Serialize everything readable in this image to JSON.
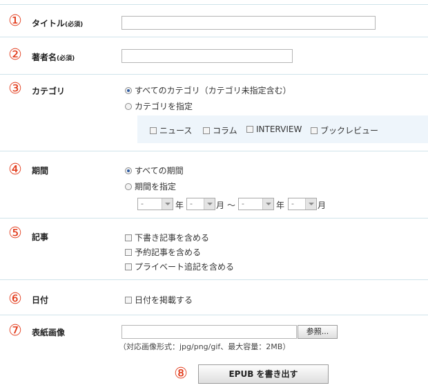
{
  "steps": [
    "①",
    "②",
    "③",
    "④",
    "⑤",
    "⑥",
    "⑦",
    "⑧"
  ],
  "title_field": {
    "label": "タイトル",
    "required": "(必須)",
    "value": ""
  },
  "author_field": {
    "label": "著者名",
    "required": "(必須)",
    "value": ""
  },
  "category": {
    "label": "カテゴリ",
    "options": [
      "すべてのカテゴリ（カテゴリ未指定含む）",
      "カテゴリを指定"
    ],
    "selected": 0,
    "checkboxes": [
      "ニュース",
      "コラム",
      "INTERVIEW",
      "ブックレビュー"
    ]
  },
  "period": {
    "label": "期間",
    "options": [
      "すべての期間",
      "期間を指定"
    ],
    "selected": 0,
    "select_placeholder": "-",
    "units": {
      "year": "年",
      "month": "月",
      "tilde": "～"
    }
  },
  "articles": {
    "label": "記事",
    "checkboxes": [
      "下書き記事を含める",
      "予約記事を含める",
      "プライベート追記を含める"
    ]
  },
  "date": {
    "label": "日付",
    "checkbox": "日付を掲載する"
  },
  "cover": {
    "label": "表紙画像",
    "browse_button": "参照...",
    "note": "（対応画像形式：jpg/png/gif、最大容量：2MB）"
  },
  "export_button": "EPUB を書き出す",
  "colors": {
    "accent": "#e23a1a",
    "divider": "#cfe3ea",
    "category_box": "#eef5fb"
  }
}
